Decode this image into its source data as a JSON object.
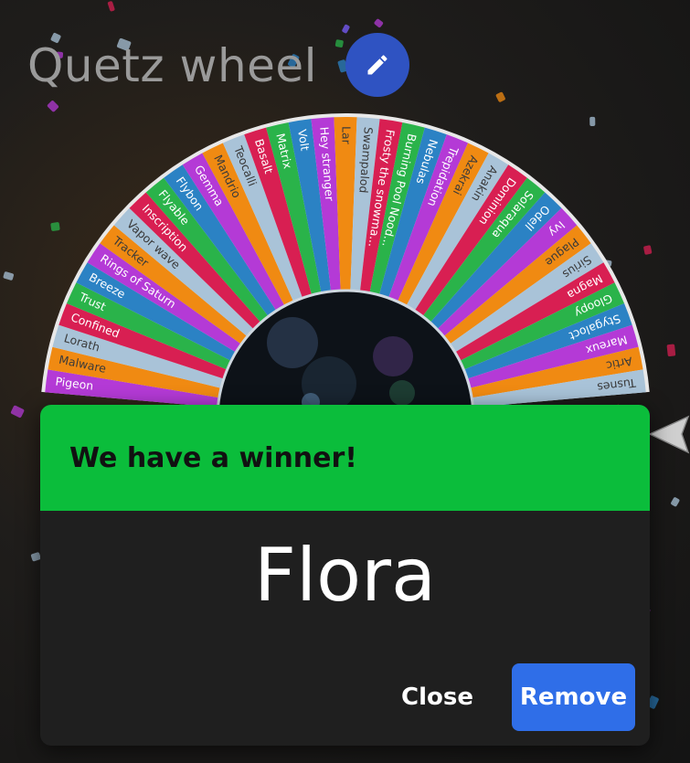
{
  "app": {
    "title": "Quetz wheel"
  },
  "header": {
    "edit_icon": "pencil-icon",
    "edit_color": "#2f53c2"
  },
  "wheel": {
    "segments": [
      {
        "label": "Pigeon",
        "color": "#b43ad6"
      },
      {
        "label": "Malware",
        "color": "#f08a12"
      },
      {
        "label": "Lorath",
        "color": "#a9c3d8"
      },
      {
        "label": "Confined",
        "color": "#d81f52"
      },
      {
        "label": "Trust",
        "color": "#2ab34a"
      },
      {
        "label": "Breeze",
        "color": "#2b82c4"
      },
      {
        "label": "Rings of Saturn",
        "color": "#b43ad6"
      },
      {
        "label": "Tracker",
        "color": "#f08a12"
      },
      {
        "label": "Vapor wave",
        "color": "#a9c3d8"
      },
      {
        "label": "Inscription",
        "color": "#d81f52"
      },
      {
        "label": "Flyable",
        "color": "#2ab34a"
      },
      {
        "label": "Flybon",
        "color": "#2b82c4"
      },
      {
        "label": "Gemma",
        "color": "#b43ad6"
      },
      {
        "label": "Mandrio",
        "color": "#f08a12"
      },
      {
        "label": "Teocalli",
        "color": "#a9c3d8"
      },
      {
        "label": "Basalt",
        "color": "#d81f52"
      },
      {
        "label": "Matrix",
        "color": "#2ab34a"
      },
      {
        "label": "Volt",
        "color": "#2b82c4"
      },
      {
        "label": "Hey stranger",
        "color": "#b43ad6"
      },
      {
        "label": "Lar",
        "color": "#f08a12"
      },
      {
        "label": "Swampalod",
        "color": "#a9c3d8"
      },
      {
        "label": "Frosty the snowma...",
        "color": "#d81f52"
      },
      {
        "label": "Burning Pool Nood...",
        "color": "#2ab34a"
      },
      {
        "label": "Nebulas",
        "color": "#2b82c4"
      },
      {
        "label": "Trepidation",
        "color": "#b43ad6"
      },
      {
        "label": "Azekrai",
        "color": "#f08a12"
      },
      {
        "label": "Anakin",
        "color": "#a9c3d8"
      },
      {
        "label": "Dominion",
        "color": "#d81f52"
      },
      {
        "label": "Solaraqua",
        "color": "#2ab34a"
      },
      {
        "label": "Odell",
        "color": "#2b82c4"
      },
      {
        "label": "Ivy",
        "color": "#b43ad6"
      },
      {
        "label": "Plague",
        "color": "#f08a12"
      },
      {
        "label": "Sirius",
        "color": "#a9c3d8"
      },
      {
        "label": "Magna",
        "color": "#d81f52"
      },
      {
        "label": "Gloopy",
        "color": "#2ab34a"
      },
      {
        "label": "Stygaloct",
        "color": "#2b82c4"
      },
      {
        "label": "Mareux",
        "color": "#b43ad6"
      },
      {
        "label": "Artic",
        "color": "#f08a12"
      },
      {
        "label": "Tusnes",
        "color": "#a9c3d8"
      }
    ]
  },
  "dialog": {
    "title": "We have a winner!",
    "winner": "Flora",
    "close_label": "Close",
    "remove_label": "Remove",
    "header_color": "#0bbd3b",
    "remove_color": "#2f6ee8"
  },
  "confetti_colors": [
    "#f08a12",
    "#2b82c4",
    "#b43ad6",
    "#2ab34a",
    "#a9c3d8",
    "#d81f52",
    "#7a5cff"
  ]
}
